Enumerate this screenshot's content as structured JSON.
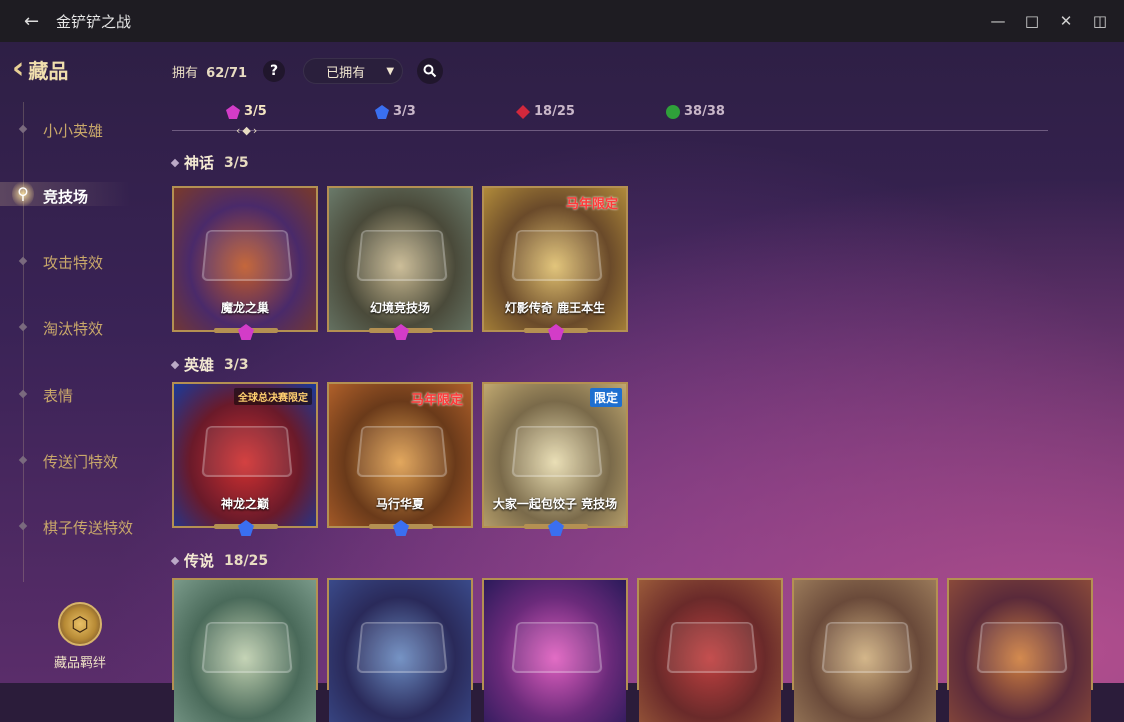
{
  "window": {
    "title": "金铲铲之战",
    "back_icon": "back-arrow-icon",
    "controls": [
      "minimize-icon",
      "maximize-icon",
      "close-icon",
      "sidebar-toggle-icon"
    ]
  },
  "sidebar": {
    "title": "藏品",
    "items": [
      {
        "label": "小小英雄",
        "active": false
      },
      {
        "label": "竞技场",
        "active": true
      },
      {
        "label": "攻击特效",
        "active": false
      },
      {
        "label": "淘汰特效",
        "active": false
      },
      {
        "label": "表情",
        "active": false
      },
      {
        "label": "传送门特效",
        "active": false
      },
      {
        "label": "棋子传送特效",
        "active": false
      }
    ],
    "bond_label": "藏品羁绊"
  },
  "toolbar": {
    "owned_label": "拥有",
    "owned_count": "62/71",
    "help": "?",
    "filter_value": "已拥有"
  },
  "tiers": [
    {
      "count": "3/5",
      "color": "#d33cc8",
      "icon": "mythic-gem-icon"
    },
    {
      "count": "3/3",
      "color": "#3a6ff0",
      "icon": "hero-gem-icon"
    },
    {
      "count": "18/25",
      "color": "#d2283c",
      "icon": "legend-gem-icon"
    },
    {
      "count": "38/38",
      "color": "#2fa03a",
      "icon": "epic-orb-icon"
    }
  ],
  "sections": {
    "mythic": {
      "name": "神话",
      "count": "3/5"
    },
    "hero": {
      "name": "英雄",
      "count": "3/3"
    },
    "legend": {
      "name": "传说",
      "count": "18/25"
    }
  },
  "cards": {
    "mythic": [
      {
        "name": "魔龙之巢",
        "badge": "",
        "colors": [
          "#7a3a2a",
          "#4a2a6a",
          "#c05a2a"
        ]
      },
      {
        "name": "幻境竞技场",
        "badge": "",
        "colors": [
          "#6a7a6a",
          "#4a4a3a",
          "#c8b890"
        ]
      },
      {
        "name": "灯影传奇  鹿王本生",
        "badge": "马年限定",
        "colors": [
          "#b08a3a",
          "#6a4a2a",
          "#e0c070"
        ]
      }
    ],
    "hero": [
      {
        "name": "神龙之巅",
        "badge": "全球总决赛限定",
        "colors": [
          "#1a3a9a",
          "#6a1a2a",
          "#d03030"
        ]
      },
      {
        "name": "马行华夏",
        "badge": "马年限定",
        "colors": [
          "#b0602a",
          "#6a3a1a",
          "#e0a050"
        ]
      },
      {
        "name": "大家一起包饺子  竞技场",
        "badge": "限定",
        "colors": [
          "#c0a870",
          "#7a6a4a",
          "#e8dcb0"
        ]
      }
    ],
    "legend": [
      {
        "name": "",
        "badge": "",
        "colors": [
          "#7a9a8a",
          "#4a6a5a",
          "#c0d0b0"
        ]
      },
      {
        "name": "",
        "badge": "",
        "colors": [
          "#3a4a8a",
          "#2a2a5a",
          "#6a8ac0"
        ]
      },
      {
        "name": "",
        "badge": "",
        "colors": [
          "#2a1a5a",
          "#6a2a7a",
          "#e060c0"
        ]
      },
      {
        "name": "",
        "badge": "",
        "colors": [
          "#9a5a3a",
          "#6a2a2a",
          "#c04040"
        ]
      },
      {
        "name": "",
        "badge": "",
        "colors": [
          "#9a7a5a",
          "#6a4a3a",
          "#d0b080"
        ]
      },
      {
        "name": "",
        "badge": "",
        "colors": [
          "#8a4a3a",
          "#5a2a3a",
          "#d08040"
        ]
      }
    ]
  }
}
